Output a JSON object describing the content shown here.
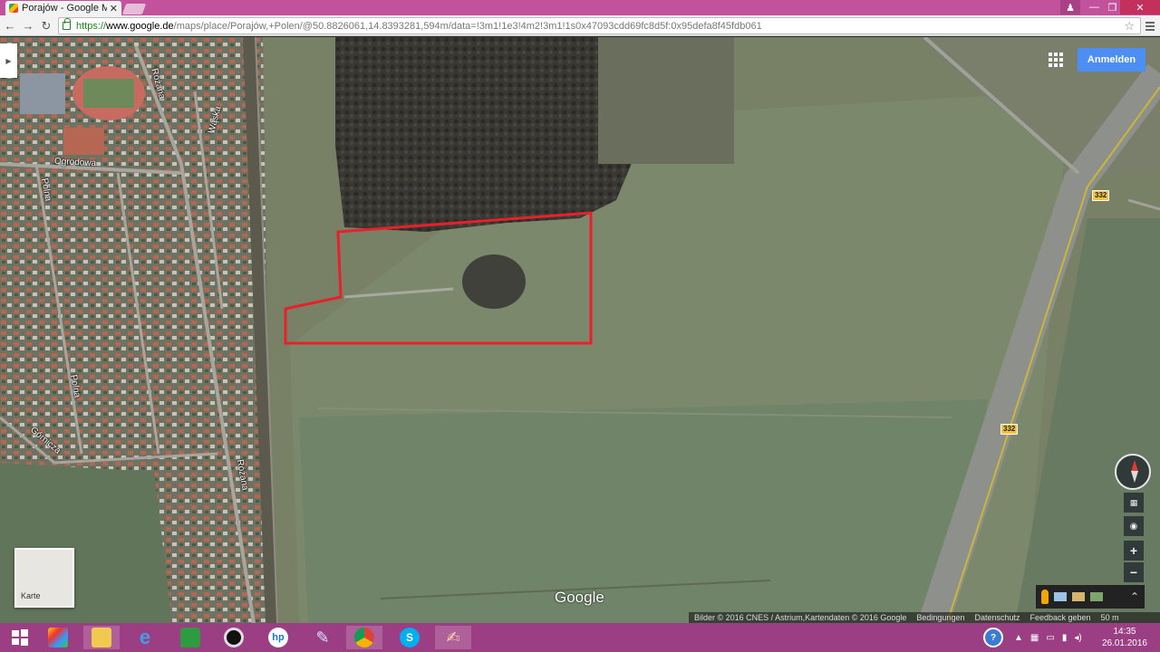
{
  "browser": {
    "tab_title": "Porajów - Google Ma",
    "tab_close": "✕",
    "url_scheme": "https://",
    "url_host": "www.google.de",
    "url_path": "/maps/place/Porajów,+Polen/@50.8826061,14.8393281,594m/data=!3m1!1e3!4m2!3m1!1s0x47093cdd69fc8d5f:0x95defa8f45fdb061",
    "win_user": "♟",
    "win_minimize": "—",
    "win_maximize": "❐",
    "win_close": "✕",
    "back": "←",
    "forward": "→",
    "reload": "↻",
    "star": "☆"
  },
  "map": {
    "sidepanel_toggle": "▶",
    "signin_label": "Anmelden",
    "street_labels": [
      "Różana",
      "Wąska",
      "Ogrodowa",
      "Polna",
      "Polna",
      "Górnicza",
      "Różana"
    ],
    "road_shields": [
      "332",
      "332"
    ],
    "layer_label": "Karte",
    "google_logo": "Google",
    "zoom_in": "+",
    "zoom_out": "−",
    "pegman_expand": "⌃",
    "footer": {
      "imagery": "Bilder © 2016 CNES / Astrium,Kartendaten © 2016 Google",
      "terms": "Bedingungen",
      "privacy": "Datenschutz",
      "feedback": "Feedback geben",
      "scale": "50 m"
    }
  },
  "taskbar": {
    "time": "14:35",
    "date": "26.01.2016"
  },
  "colors": {
    "titlebar": "#c3529c",
    "taskbar": "#9c3e84",
    "parcel_outline": "#e8202a",
    "signin": "#4d8ef4"
  }
}
